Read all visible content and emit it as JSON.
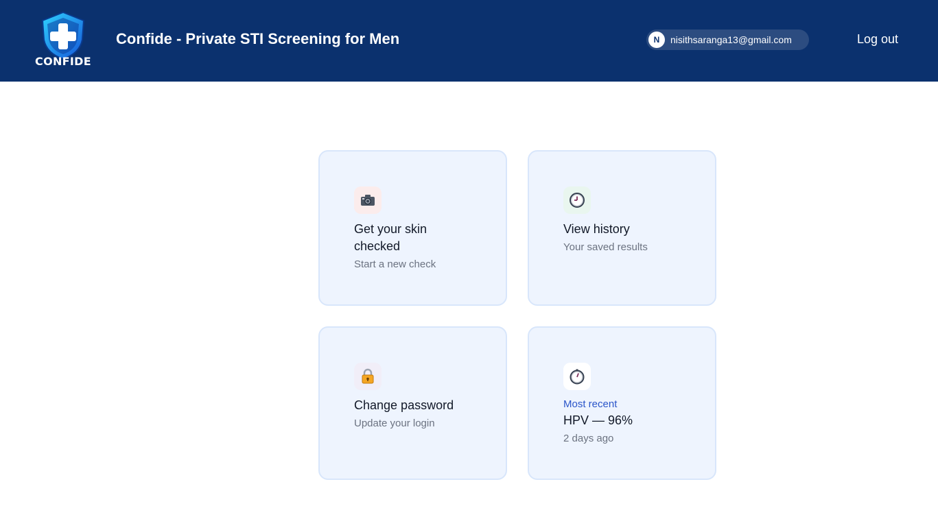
{
  "header": {
    "logo_text": "CONFIDE",
    "title": "Confide - Private STI Screening for Men",
    "user_initial": "N",
    "user_email": "nisithsaranga13@gmail.com",
    "logout_label": "Log out"
  },
  "cards": [
    {
      "icon": "camera-icon",
      "title": "Get your skin checked",
      "subtitle": "Start a new check"
    },
    {
      "icon": "clock-icon",
      "title": "View history",
      "subtitle": "Your saved results"
    },
    {
      "icon": "lock-icon",
      "title": "Change password",
      "subtitle": "Update your login"
    },
    {
      "icon": "timer-icon",
      "label": "Most recent",
      "title": "HPV — 96%",
      "subtitle": "2 days ago"
    }
  ],
  "colors": {
    "header_bg": "#0b316e",
    "card_bg": "#eef4fe",
    "accent": "#2a55c9"
  }
}
